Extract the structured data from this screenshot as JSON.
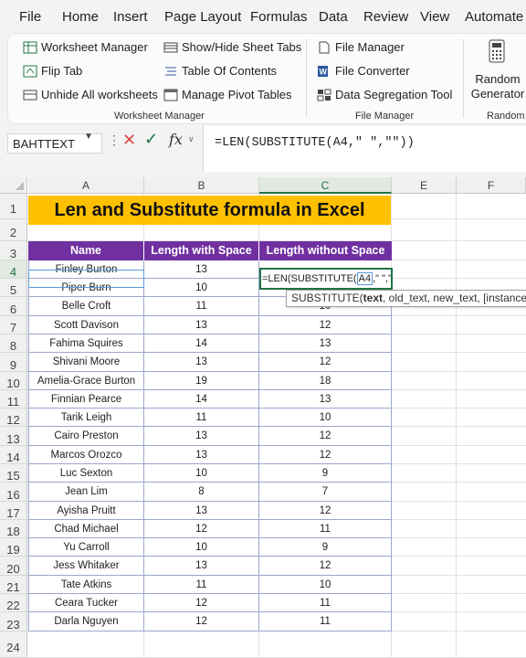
{
  "menu": [
    "File",
    "Home",
    "Insert",
    "Page Layout",
    "Formulas",
    "Data",
    "Review",
    "View",
    "Automate"
  ],
  "ribbon": {
    "worksheet_manager": {
      "items": [
        "Worksheet Manager",
        "Flip Tab",
        "Unhide All worksheets",
        "Show/Hide Sheet Tabs",
        "Table Of Contents",
        "Manage Pivot Tables"
      ],
      "label": "Worksheet Manager"
    },
    "file_manager": {
      "items": [
        "File Manager",
        "File Converter",
        "Data Segregation Tool"
      ],
      "label": "File Manager"
    },
    "random": {
      "button_line1": "Random",
      "button_line2": "Generator",
      "label": "Random"
    }
  },
  "formula_bar": {
    "name_box": "BAHTTEXT",
    "fx": "fx",
    "formula": "=LEN(SUBSTITUTE(A4,\" \",\"\"))"
  },
  "columns": [
    "A",
    "B",
    "C",
    "E",
    "F"
  ],
  "rows": [
    "1",
    "2",
    "3",
    "4",
    "5",
    "6",
    "7",
    "8",
    "9",
    "10",
    "11",
    "12",
    "13",
    "14",
    "15",
    "16",
    "17",
    "18",
    "19",
    "20",
    "21",
    "22",
    "23",
    "24"
  ],
  "sheet": {
    "title": "Len and Substitute formula in Excel",
    "headers": [
      "Name",
      "Length with Space",
      "Length without Space"
    ],
    "editing_cell": {
      "before": "=LEN(SUBSTITUTE(",
      "ref": "A4",
      "after": ",\" \",\"\"))"
    },
    "tooltip": {
      "fn": "SUBSTITUTE(",
      "arg1": "text",
      "rest": ", old_text, new_text, [instance_num])"
    },
    "data": [
      [
        "Finley Burton",
        "13",
        ""
      ],
      [
        "Piper Burn",
        "10",
        ""
      ],
      [
        "Belle Croft",
        "11",
        "10"
      ],
      [
        "Scott Davison",
        "13",
        "12"
      ],
      [
        "Fahima Squires",
        "14",
        "13"
      ],
      [
        "Shivani Moore",
        "13",
        "12"
      ],
      [
        "Amelia-Grace Burton",
        "19",
        "18"
      ],
      [
        "Finnian Pearce",
        "14",
        "13"
      ],
      [
        "Tarik Leigh",
        "11",
        "10"
      ],
      [
        "Cairo Preston",
        "13",
        "12"
      ],
      [
        "Marcos Orozco",
        "13",
        "12"
      ],
      [
        "Luc Sexton",
        "10",
        "9"
      ],
      [
        "Jean Lim",
        "8",
        "7"
      ],
      [
        "Ayisha Pruitt",
        "13",
        "12"
      ],
      [
        "Chad Michael",
        "12",
        "11"
      ],
      [
        "Yu Carroll",
        "10",
        "9"
      ],
      [
        "Jess Whitaker",
        "13",
        "12"
      ],
      [
        "Tate Atkins",
        "11",
        "10"
      ],
      [
        "Ceara Tucker",
        "12",
        "11"
      ],
      [
        "Darla Nguyen",
        "12",
        "11"
      ]
    ]
  },
  "colors": {
    "title_fill": "#ffc000",
    "header_fill": "#7030a0",
    "active_green": "#217346",
    "error_red": "#e04545"
  }
}
